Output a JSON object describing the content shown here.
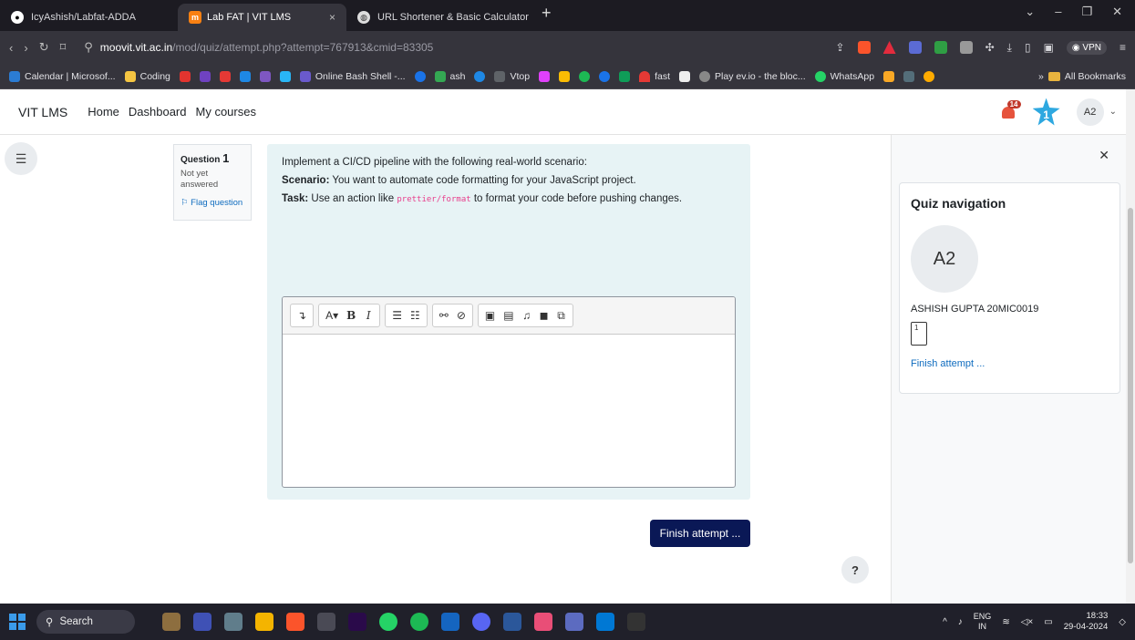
{
  "browser": {
    "tabs": [
      {
        "label": "IcyAshish/Labfat-ADDA",
        "favicon": "github-icon"
      },
      {
        "label": "Lab FAT | VIT LMS",
        "favicon": "moodle-icon",
        "active": true,
        "close": "×"
      },
      {
        "label": "URL Shortener & Basic Calculator",
        "favicon": "url-icon"
      }
    ],
    "new_tab": "+",
    "url_host": "moovit.vit.ac.in",
    "url_path": "/mod/quiz/attempt.php?attempt=767913&cmid=83305",
    "vpn_label": "VPN",
    "bookmarks": [
      {
        "label": "Calendar | Microsof...",
        "color": "#2b7cd3"
      },
      {
        "label": "Coding",
        "color": "#f5c542"
      },
      {
        "label": "",
        "color": "#e3342f"
      },
      {
        "label": "",
        "color": "#6f42c1"
      },
      {
        "label": "",
        "color": "#1e88e5"
      },
      {
        "label": "Online Bash Shell -...",
        "color": "#6a5acd"
      },
      {
        "label": "ash",
        "color": "#34a853"
      },
      {
        "label": "Vtop",
        "color": "#5f6368"
      },
      {
        "label": "fast",
        "color": "#e53935"
      },
      {
        "label": "Play ev.io - the bloc...",
        "color": "#888888"
      },
      {
        "label": "WhatsApp",
        "color": "#25d366"
      }
    ],
    "all_bookmarks": "All Bookmarks"
  },
  "navbar": {
    "brand": "VIT LMS",
    "links": [
      "Home",
      "Dashboard",
      "My courses"
    ],
    "notification_count": "14",
    "star_count": "1",
    "user_initials": "A2"
  },
  "question": {
    "title_prefix": "Question",
    "number": "1",
    "status": "Not yet answered",
    "flag_label": "Flag question",
    "intro": "Implement a CI/CD pipeline with the following real-world scenario:",
    "scenario_label": "Scenario:",
    "scenario_text": " You want to automate code formatting for your JavaScript project.",
    "task_label": "Task:",
    "task_pre": " Use an action like ",
    "task_code": "prettier/format",
    "task_post": " to format your code before pushing changes."
  },
  "editor": {
    "toolbar": [
      "↴",
      "A▾",
      "B",
      "I",
      "☰",
      "☷",
      "⚯",
      "⊘",
      "▣",
      "▤",
      "♫",
      "◼",
      "⧉"
    ]
  },
  "finish_button": "Finish attempt ...",
  "help_label": "?",
  "quiz_nav": {
    "title": "Quiz navigation",
    "user_initials": "A2",
    "user_name": "ASHISH GUPTA 20MIC0019",
    "question_button": "1",
    "finish_link": "Finish attempt ..."
  },
  "taskbar": {
    "search_label": "Search",
    "lang_top": "ENG",
    "lang_bottom": "IN",
    "time": "18:33",
    "date": "29-04-2024"
  }
}
